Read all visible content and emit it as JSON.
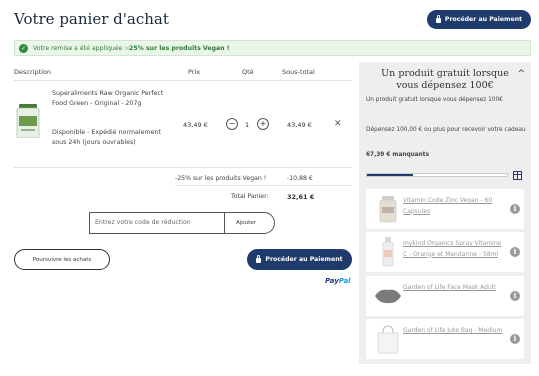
{
  "header": {
    "title": "Votre panier d'achat",
    "checkout_label": "Procéder au Paiement"
  },
  "banner": {
    "prefix": "Votre remise a été appliquée : ",
    "highlight": "-25% sur les produits Vegan !"
  },
  "table": {
    "headers": {
      "description": "Description",
      "price": "Prix",
      "qty": "Qté",
      "subtotal": "Sous-total"
    },
    "item": {
      "name": "Superaliments Raw Organic Perfect Food Green - Original - 207g",
      "availability": "Disponible - Expédié normalement sous 24h (jours ouvrables)",
      "price": "43,49 €",
      "qty_minus": "−",
      "quantity": "1",
      "qty_plus": "+",
      "subtotal": "43,49 €",
      "remove": "✕"
    },
    "discount_label": "-25% sur les produits Vegan !",
    "discount_value": "-10,88 €",
    "total_label": "Total Panier:",
    "total_value": "32,61 €"
  },
  "coupon": {
    "placeholder": "Entrez votre code de réduction",
    "button": "Ajouter"
  },
  "actions": {
    "continue_label": "Poursuivre les achats",
    "checkout_label": "Procéder au Paiement",
    "paypal_1": "Pay",
    "paypal_2": "Pal"
  },
  "sidebar": {
    "title": "Un produit gratuit lorsque vous dépensez 100€",
    "chevron": "^",
    "subtitle": "Un produit gratuit lorsque vous dépensez 100€",
    "description": "Dépensez 100,00 € ou plus pour recevoir votre cadeau",
    "remaining": "67,39 € manquants",
    "progress_fraction": 0.33,
    "items": [
      {
        "name": "Vitamin Code Zinc Vegan - 60 Capsules",
        "icon": "bottle",
        "info": "i"
      },
      {
        "name": "mykind Organics Spray Vitamine C - Orange et Mandarine - 58ml",
        "icon": "spray",
        "info": "i"
      },
      {
        "name": "Garden of Life Face Mask Adult",
        "icon": "mask",
        "info": "i"
      },
      {
        "name": "Garden of Life Jute Bag - Medium",
        "icon": "bag",
        "info": "i"
      }
    ]
  },
  "colors": {
    "primary": "#1f3b6b",
    "success": "#2e8b3a",
    "sidebar_bg": "#eeeeee"
  }
}
